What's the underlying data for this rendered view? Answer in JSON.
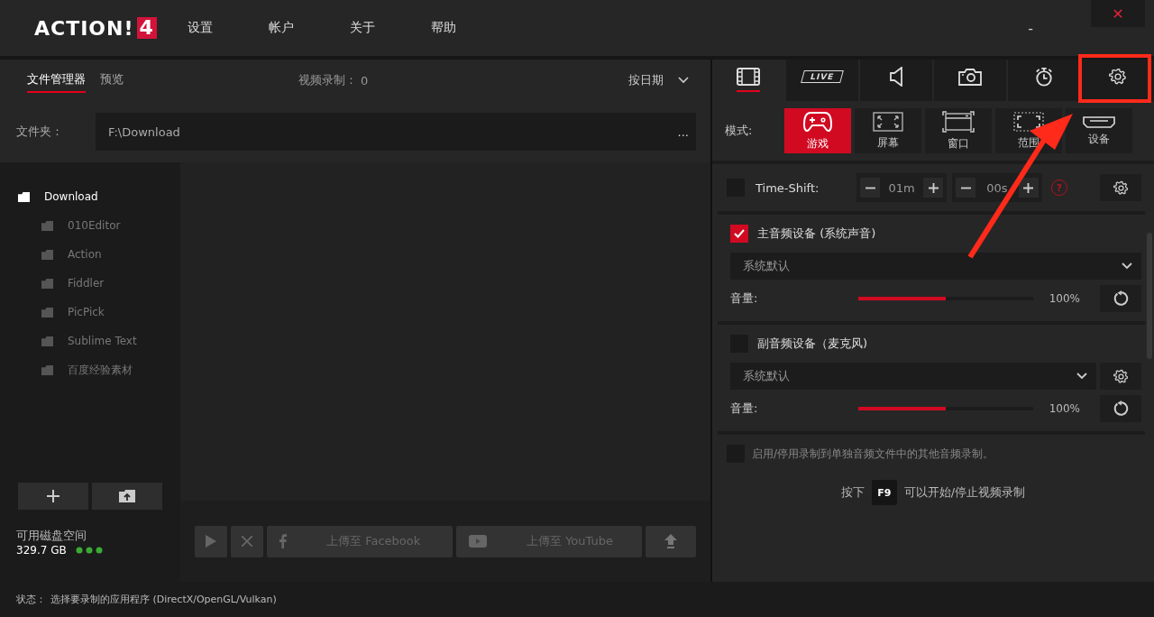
{
  "app": {
    "logo": "ACTION!",
    "logo_badge": "4"
  },
  "menu": [
    "设置",
    "帐户",
    "关于",
    "帮助"
  ],
  "window_controls": {
    "minimize": "-",
    "close": "✕"
  },
  "left": {
    "tabs": [
      {
        "label": "文件管理器",
        "selected": true
      },
      {
        "label": "预览",
        "selected": false
      }
    ],
    "video_count_label": "视频录制：",
    "video_count": "0",
    "sort": "按日期",
    "folder_label": "文件夹：",
    "folder_path": "F:\\Download",
    "folder_more": "...",
    "tree": [
      {
        "name": "Download",
        "selected": true,
        "children": [
          {
            "name": "010Editor",
            "selected": false
          },
          {
            "name": "Action",
            "selected": false
          },
          {
            "name": "Fiddler",
            "selected": false
          },
          {
            "name": "PicPick",
            "selected": false
          },
          {
            "name": "Sublime Text",
            "selected": false
          },
          {
            "name": "百度经验素材",
            "selected": false
          }
        ]
      }
    ],
    "disk_label": "可用磁盘空间",
    "disk_value": "329.7 GB",
    "actions": [
      {
        "kind": "play"
      },
      {
        "kind": "delete"
      },
      {
        "kind": "facebook",
        "label": "上傳至 Facebook"
      },
      {
        "kind": "youtube",
        "label": "上傳至 YouTube"
      },
      {
        "kind": "upload"
      }
    ]
  },
  "right": {
    "tabs": [
      {
        "kind": "video",
        "selected": true
      },
      {
        "kind": "live",
        "label": "LIVE",
        "selected": false
      },
      {
        "kind": "audio",
        "selected": false
      },
      {
        "kind": "camera",
        "selected": false
      },
      {
        "kind": "timer",
        "selected": false
      },
      {
        "kind": "settings",
        "selected": false
      }
    ],
    "mode_label": "模式:",
    "modes": [
      {
        "kind": "game",
        "label": "游戏",
        "selected": true
      },
      {
        "kind": "screen",
        "label": "屏幕",
        "selected": false
      },
      {
        "kind": "window",
        "label": "窗口",
        "selected": false
      },
      {
        "kind": "region",
        "label": "范围",
        "selected": false
      },
      {
        "kind": "device",
        "label": "设备",
        "selected": false
      }
    ],
    "timeshift": {
      "checked": false,
      "label": "Time-Shift:",
      "minutes": "01m",
      "seconds": "00s",
      "help": "?"
    },
    "audio": [
      {
        "checked": true,
        "label": "主音频设备 (系统声音)",
        "device": "系统默认",
        "has_settings": false,
        "volume_label": "音量:",
        "level": 0.5,
        "reading": "100%"
      },
      {
        "checked": false,
        "label": "副音频设备（麦克风)",
        "device": "系统默认",
        "has_settings": true,
        "volume_label": "音量:",
        "level": 0.5,
        "reading": "100%"
      }
    ],
    "separate_audio": {
      "checked": false,
      "label": "启用/停用录制到单独音频文件中的其他音频录制。"
    },
    "hint": {
      "before": "按下",
      "key": "F9",
      "after": "可以开始/停止视频录制"
    }
  },
  "status": {
    "label": "状态：",
    "text": "选择要录制的应用程序 (DirectX/OpenGL/Vulkan)"
  }
}
